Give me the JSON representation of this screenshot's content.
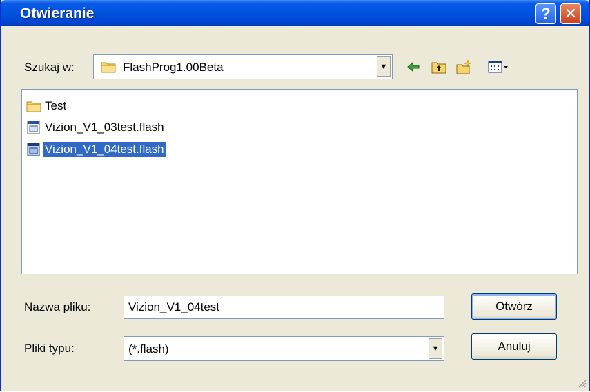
{
  "window": {
    "title": "Otwieranie"
  },
  "title_buttons": {
    "help": "?",
    "close": "✕"
  },
  "lookin": {
    "label": "Szukaj w:",
    "value": "FlashProg1.00Beta"
  },
  "toolbar": {
    "icons": [
      "back-arrow-icon",
      "up-one-level-icon",
      "new-folder-icon",
      "view-menu-icon"
    ]
  },
  "files": [
    {
      "name": "Test",
      "type": "folder",
      "selected": false
    },
    {
      "name": "Vizion_V1_03test.flash",
      "type": "file",
      "selected": false
    },
    {
      "name": "Vizion_V1_04test.flash",
      "type": "file",
      "selected": true
    }
  ],
  "filename": {
    "label": "Nazwa pliku:",
    "value": "Vizion_V1_04test"
  },
  "filetype": {
    "label": "Pliki typu:",
    "value": "(*.flash)"
  },
  "buttons": {
    "open": "Otwórz",
    "cancel": "Anuluj"
  },
  "colors": {
    "titlebar": "#0053e0",
    "selection": "#316ac5",
    "dialog_bg": "#ece9d8"
  }
}
